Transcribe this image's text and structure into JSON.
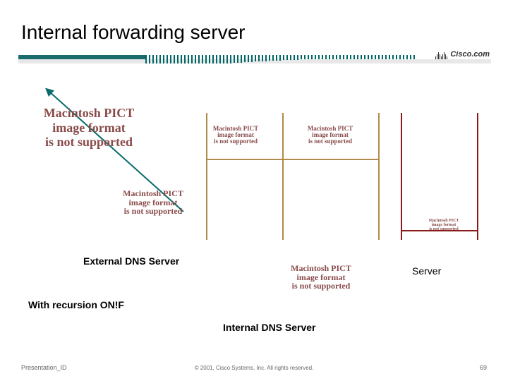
{
  "title": "Internal forwarding server",
  "logo_text": "Cisco.com",
  "pict_large": "Macintosh PICT\nimage format\nis not supported",
  "pict_small_1": "Macintosh PICT\nimage format\nis not supported",
  "pict_small_2": "Macintosh PICT\nimage format\nis not supported",
  "pict_mid": "Macintosh PICT\nimage format\nis not supported",
  "pict_tiny": "Macintosh PICT\nimage format\nis not supported",
  "pict_bottom": "Macintosh PICT\nimage format\nis not supported",
  "label_external": "External DNS Server",
  "label_server": "Server",
  "label_recursion": "With recursion ON!F",
  "label_internal": "Internal DNS Server",
  "footer_left": "Presentation_ID",
  "footer_center": "© 2001, Cisco Systems, Inc. All rights reserved.",
  "footer_right": "69"
}
